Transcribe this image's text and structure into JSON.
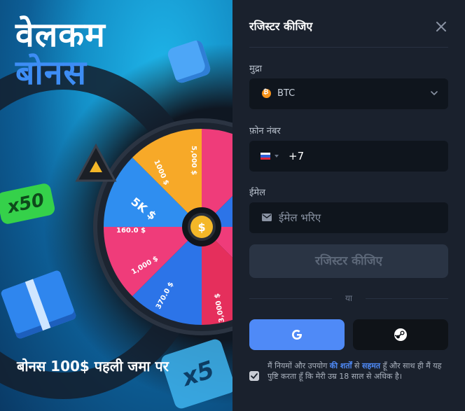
{
  "promo": {
    "title_line1": "वेलकम",
    "title_line2": "बोनस",
    "subtitle": "बोनस 100$ पहली जमा पर",
    "badge_x50": "x50",
    "badge_x5": "x5",
    "wheel_segments": [
      "5K $",
      "1000 $",
      "5,000 $",
      "160.0 $",
      "1,000 $",
      "370.0 $",
      "3,000 $"
    ],
    "colors": {
      "accent_blue": "#3d8df5",
      "green_badge": "#35d14a"
    }
  },
  "register": {
    "title": "रजिस्टर कीजिए",
    "close_icon": "close-icon",
    "currency": {
      "label": "मुद्रा",
      "value": "BTC",
      "icon": "bitcoin-icon"
    },
    "phone": {
      "label": "फ़ोन नंबर",
      "country_code": "+7",
      "flag": "russia-flag-icon"
    },
    "email": {
      "label": "ईमेल",
      "placeholder": "ईमेल भरिए",
      "icon": "mail-icon"
    },
    "submit_label": "रजिस्टर कीजिए",
    "or_label": "या",
    "social": {
      "google": "google-icon",
      "steam": "steam-icon"
    },
    "terms": {
      "prefix": "मैं नियमों और उपयोग ",
      "link1": "की शर्तों",
      "middle": " से ",
      "link2": "सहमत",
      "suffix": " हूँ और साथ ही मैं यह पुष्टि करता हूँ कि मेरी उम्र 18 साल से अधिक है।",
      "checked": true
    },
    "colors": {
      "panel_bg": "#1a212d",
      "field_bg": "#0f151d",
      "link": "#4f8af7",
      "google_btn": "#4f8af7"
    }
  }
}
